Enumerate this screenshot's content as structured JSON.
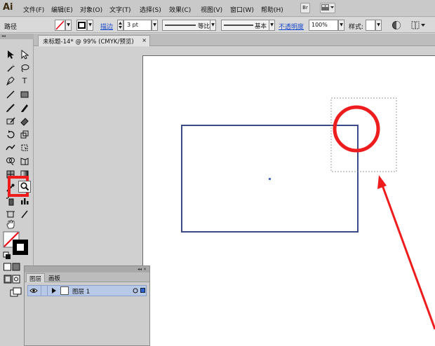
{
  "app": {
    "logo": "Ai"
  },
  "menu": {
    "items": [
      "文件(F)",
      "编辑(E)",
      "对象(O)",
      "文字(T)",
      "选择(S)",
      "效果(C)",
      "视图(V)",
      "窗口(W)",
      "帮助(H)"
    ],
    "bridge_label": "Br"
  },
  "control_bar": {
    "selection_label": "路径",
    "stroke_link": "描边",
    "stroke_weight": "3 pt",
    "profile_label": "等比",
    "brush_label": "基本",
    "opacity_link": "不透明度",
    "opacity_value": "100%",
    "style_label": "样式:"
  },
  "document": {
    "tab_title": "未标题-14* @ 99% (CMYK/预览)",
    "close_glyph": "×"
  },
  "layers_panel": {
    "tabs": [
      "图层",
      "画板"
    ],
    "layer_name": "图层 1"
  },
  "colors": {
    "annotation_red": "#ee1c1c",
    "rectangle_stroke": "#3b4a8a",
    "link_blue": "#1a49c9",
    "layer_highlight": "#b8c9e8"
  }
}
